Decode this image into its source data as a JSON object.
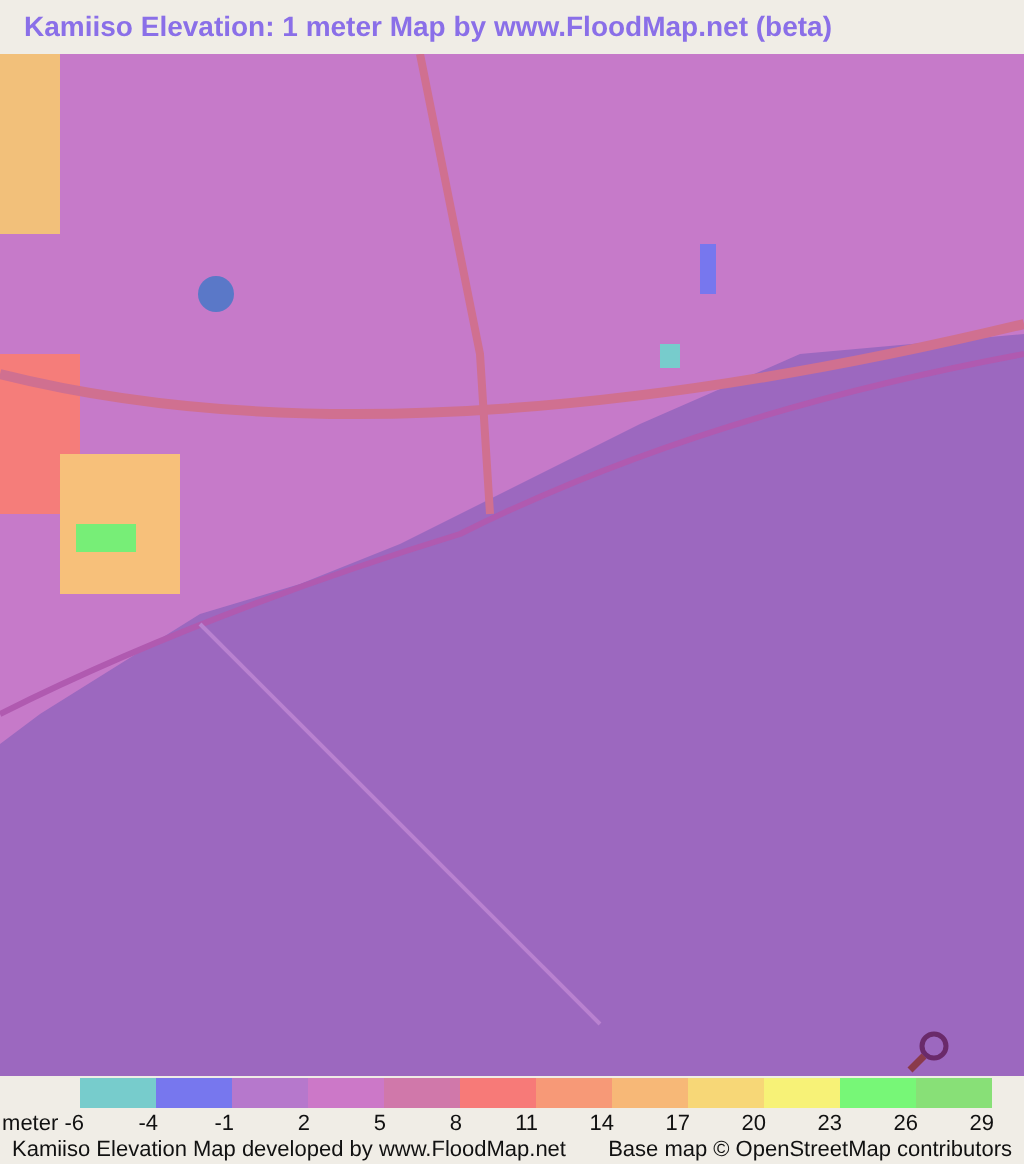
{
  "title": "Kamiiso Elevation: 1 meter Map by www.FloodMap.net (beta)",
  "legend": {
    "unit_label": "meter -6",
    "swatches": [
      {
        "color": "#77cccc",
        "label": "-4"
      },
      {
        "color": "#7777ee",
        "label": "-1"
      },
      {
        "color": "#b678cc",
        "label": "2"
      },
      {
        "color": "#cc78c8",
        "label": "5"
      },
      {
        "color": "#d078aa",
        "label": "8"
      },
      {
        "color": "#f77a78",
        "label": "11"
      },
      {
        "color": "#f79977",
        "label": "14"
      },
      {
        "color": "#f7b877",
        "label": "17"
      },
      {
        "color": "#f7d777",
        "label": "20"
      },
      {
        "color": "#f7f277",
        "label": "23"
      },
      {
        "color": "#77f777",
        "label": "26"
      },
      {
        "color": "#88e077",
        "label": "29"
      }
    ]
  },
  "footer": {
    "credit": "Kamiiso Elevation Map developed by www.FloodMap.net",
    "attribution": "Base map © OpenStreetMap contributors"
  }
}
